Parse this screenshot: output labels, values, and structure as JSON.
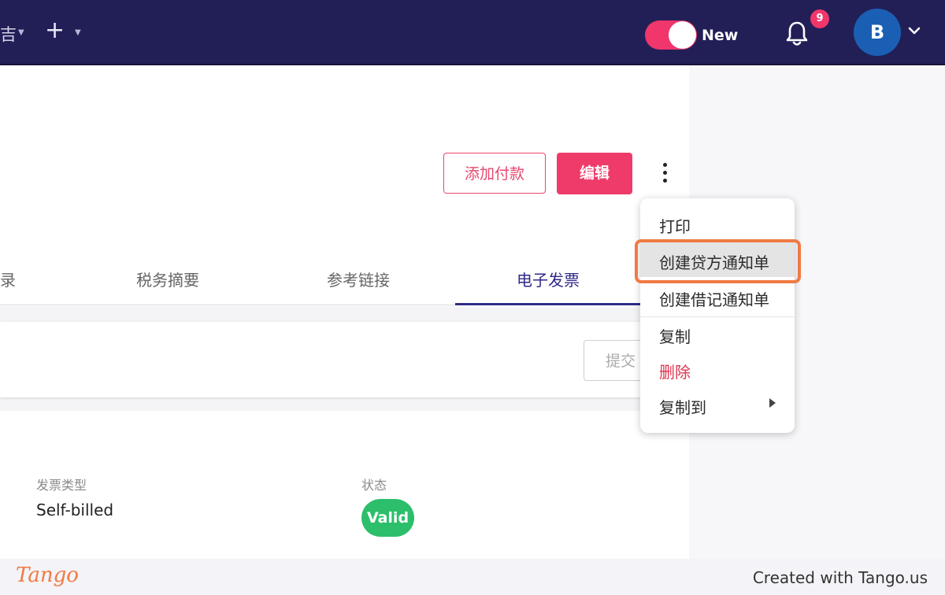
{
  "topbar": {
    "partial_text": "吉",
    "plus_symbol": "+",
    "toggle_label": "New",
    "notification_count": "9",
    "avatar_initial": "B"
  },
  "actions": {
    "add_payment": "添加付款",
    "edit": "编辑"
  },
  "tabs": [
    {
      "label": "录"
    },
    {
      "label": "税务摘要"
    },
    {
      "label": "参考链接"
    },
    {
      "label": "电子发票",
      "active": true
    }
  ],
  "panel": {
    "submit_partial": "提交"
  },
  "fields": {
    "invoice_type_label": "发票类型",
    "invoice_type_value": "Self-billed",
    "status_label": "状态",
    "status_value": "Valid"
  },
  "menu": {
    "items": [
      {
        "label": "打印"
      },
      {
        "label": "创建贷方通知单",
        "highlighted": true
      },
      {
        "label": "创建借记通知单"
      },
      {
        "label": "复制"
      },
      {
        "label": "删除",
        "danger": true
      },
      {
        "label": "复制到",
        "has_submenu": true
      }
    ]
  },
  "footer": {
    "logo": "Tango",
    "credit": "Created with Tango.us"
  },
  "colors": {
    "topbar": "#221f57",
    "accent": "#ee3b69",
    "active_tab": "#2f2a86",
    "status": "#2cbe6b",
    "highlight": "#f07a43"
  }
}
